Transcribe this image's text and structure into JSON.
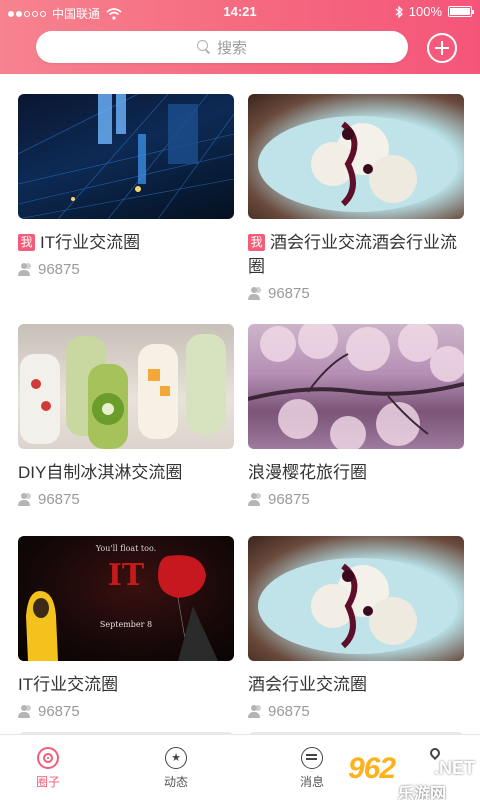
{
  "status": {
    "carrier": "中国联通",
    "time": "14:21",
    "battery": "100%"
  },
  "search": {
    "placeholder": "搜索"
  },
  "cards": [
    {
      "title": "IT行业交流圈",
      "count": "96875",
      "mine": true,
      "badge": "我"
    },
    {
      "title": "酒会行业交流酒会行业流圈",
      "count": "96875",
      "mine": true,
      "badge": "我"
    },
    {
      "title": "DIY自制冰淇淋交流圈",
      "count": "96875",
      "mine": false
    },
    {
      "title": "浪漫樱花旅行圈",
      "count": "96875",
      "mine": false
    },
    {
      "title": "IT行业交流圈",
      "count": "96875",
      "mine": false
    },
    {
      "title": "酒会行业交流圈",
      "count": "96875",
      "mine": false
    }
  ],
  "movie_poster": {
    "tagline": "You'll float too.",
    "title": "IT",
    "date": "September 8"
  },
  "tabs": [
    {
      "label": "圈子",
      "active": true,
      "icon": "circle-icon"
    },
    {
      "label": "动态",
      "active": false,
      "icon": "feed-icon"
    },
    {
      "label": "消息",
      "active": false,
      "icon": "message-icon"
    }
  ],
  "watermark": {
    "main": "962",
    "net": ".NET",
    "sub": "乐游网"
  },
  "colors": {
    "accent": "#f25d79",
    "header_start": "#f7838f",
    "header_end": "#f5557a"
  }
}
